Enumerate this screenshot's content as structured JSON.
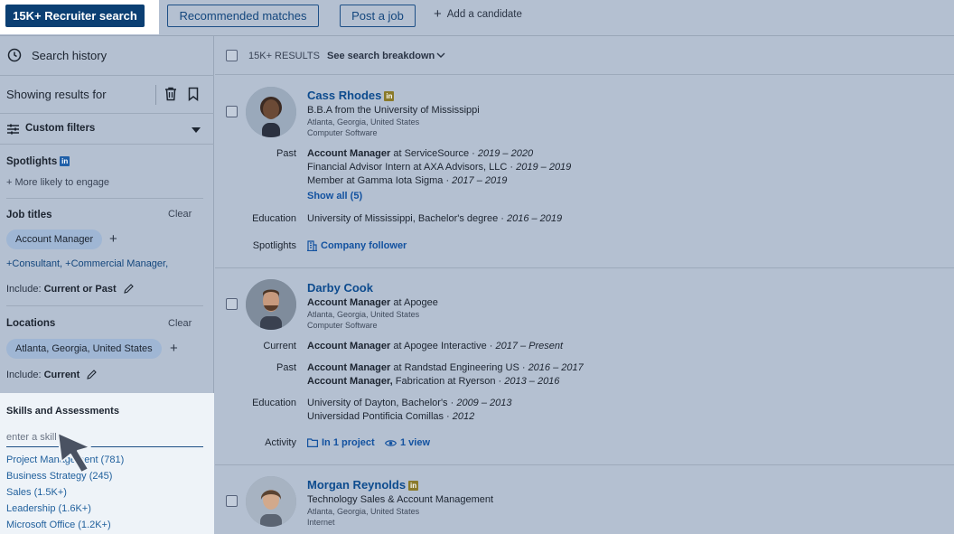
{
  "topbar": {
    "recruiter_search": "15K+ Recruiter search",
    "recommended_matches": "Recommended matches",
    "post_job": "Post a job",
    "add_candidate": "Add a candidate"
  },
  "sidebar": {
    "search_history": "Search history",
    "showing_results": "Showing results for",
    "custom_filters": "Custom filters",
    "spotlights": {
      "title": "Spotlights",
      "badge": "in",
      "more_likely": "More likely to engage"
    },
    "job_titles": {
      "title": "Job titles",
      "clear": "Clear",
      "selected": "Account Manager",
      "suggestions": [
        "+Consultant,",
        "+Commercial Manager,"
      ],
      "include_label": "Include:",
      "include_value": "Current or Past"
    },
    "locations": {
      "title": "Locations",
      "clear": "Clear",
      "selected": "Atlanta, Georgia, United States",
      "include_label": "Include:",
      "include_value": "Current"
    },
    "skills": {
      "title": "Skills and Assessments",
      "placeholder": "enter a skill",
      "items": [
        "Project Management (781)",
        "Business Strategy (245)",
        "Sales (1.5K+)",
        "Leadership (1.6K+)",
        "Microsoft Office (1.2K+)"
      ]
    }
  },
  "results": {
    "count": "15K+ RESULTS",
    "breakdown": "See search breakdown",
    "candidates": [
      {
        "name": "Cass Rhodes",
        "badge": "in",
        "headline": "B.B.A from the University of Mississippi",
        "location": "Atlanta, Georgia, United States",
        "industry": "Computer Software",
        "past_label": "Past",
        "past": [
          {
            "title": "Account Manager",
            "rest": " at ServiceSource · ",
            "dates": "2019 – 2020"
          },
          {
            "title": "",
            "rest": "Financial Advisor Intern at AXA Advisors, LLC · ",
            "dates": "2019 – 2019"
          },
          {
            "title": "",
            "rest": "Member at Gamma Iota Sigma · ",
            "dates": "2017 – 2019"
          }
        ],
        "show_all": "Show all (5)",
        "education_label": "Education",
        "education": {
          "rest": "University of Mississippi, Bachelor's degree · ",
          "dates": "2016 – 2019"
        },
        "spotlights_label": "Spotlights",
        "spotlight": "Company follower"
      },
      {
        "name": "Darby Cook",
        "headline_title": "Account Manager",
        "headline_rest": " at Apogee",
        "location": "Atlanta, Georgia, United States",
        "industry": "Computer Software",
        "current_label": "Current",
        "current": {
          "title": "Account Manager",
          "rest": " at Apogee Interactive · ",
          "dates": "2017 – Present"
        },
        "past_label": "Past",
        "past": [
          {
            "title": "Account Manager",
            "rest": " at Randstad Engineering US · ",
            "dates": "2016 – 2017"
          },
          {
            "title": "Account Manager,",
            "rest": " Fabrication at Ryerson · ",
            "dates": "2013 – 2016"
          }
        ],
        "education_label": "Education",
        "education": [
          {
            "rest": "University of Dayton, Bachelor's · ",
            "dates": "2009 – 2013"
          },
          {
            "rest": "Universidad Pontificia Comillas · ",
            "dates": "2012"
          }
        ],
        "activity_label": "Activity",
        "activity_project": "In 1 project",
        "activity_view": "1 view"
      },
      {
        "name": "Morgan Reynolds",
        "badge": "in",
        "headline": "Technology Sales & Account Management",
        "location": "Atlanta, Georgia, United States",
        "industry": "Internet"
      }
    ]
  },
  "colors": {
    "primary": "#0b3f73",
    "link": "#0d4b8e",
    "overlay_bg": "#b4c0d1",
    "highlight_bg": "#ffffff"
  }
}
